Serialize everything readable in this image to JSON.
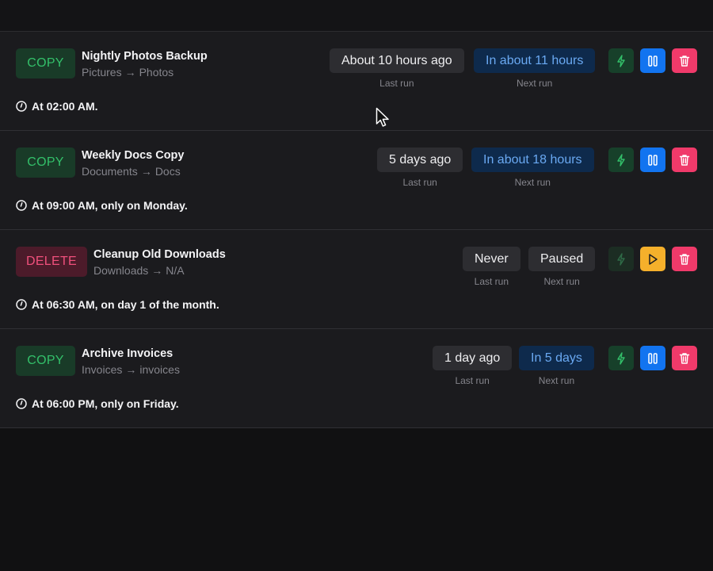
{
  "jobs": [
    {
      "type": "COPY",
      "name": "Nightly Photos Backup",
      "source": "Pictures",
      "arrow": "→",
      "destination": "Photos",
      "schedule": "At 02:00 AM.",
      "last_run": "About 10 hours ago",
      "last_run_caption": "Last run",
      "next_run": "In about 11 hours",
      "next_run_caption": "Next run",
      "state": "active"
    },
    {
      "type": "COPY",
      "name": "Weekly Docs Copy",
      "source": "Documents",
      "arrow": "→",
      "destination": "Docs",
      "schedule": "At 09:00 AM, only on Monday.",
      "last_run": "5 days ago",
      "last_run_caption": "Last run",
      "next_run": "In about 18 hours",
      "next_run_caption": "Next run",
      "state": "active"
    },
    {
      "type": "DELETE",
      "name": "Cleanup Old Downloads",
      "source": "Downloads",
      "arrow": "→",
      "destination": "N/A",
      "schedule": "At 06:30 AM, on day 1 of the month.",
      "last_run": "Never",
      "last_run_caption": "Last run",
      "next_run": "Paused",
      "next_run_caption": "Next run",
      "state": "paused"
    },
    {
      "type": "COPY",
      "name": "Archive Invoices",
      "source": "Invoices",
      "arrow": "→",
      "destination": "invoices",
      "schedule": "At 06:00 PM, only on Friday.",
      "last_run": "1 day ago",
      "last_run_caption": "Last run",
      "next_run": "In 5 days",
      "next_run_caption": "Next run",
      "state": "active"
    }
  ],
  "icons": {
    "run": "lightning-icon",
    "pause": "pause-icon",
    "resume": "play-icon",
    "delete": "trash-icon",
    "schedule": "clock-icon"
  },
  "colors": {
    "copy_badge_text": "#33c06a",
    "delete_badge_text": "#f0507c",
    "pause_button": "#1274f0",
    "resume_button": "#f5b02b",
    "delete_button": "#f03a6a",
    "next_run_text": "#6aa9f2"
  }
}
